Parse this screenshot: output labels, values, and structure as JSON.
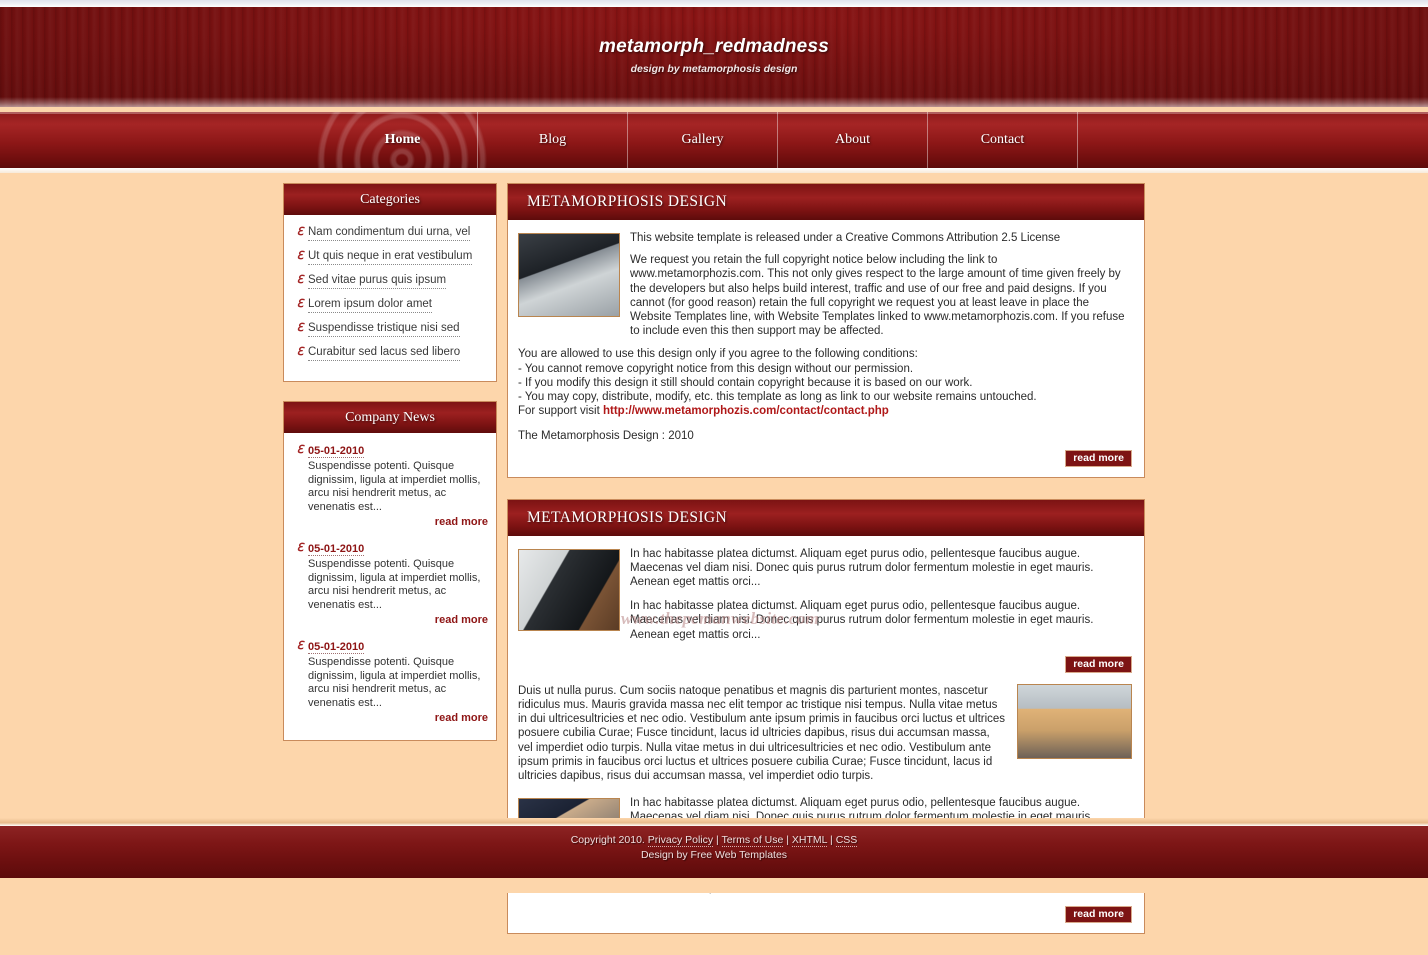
{
  "site": {
    "title": "metamorph_redmadness",
    "subtitle": "design by metamorphosis design",
    "watermark": "www.thepcmanwebsite.com"
  },
  "nav": {
    "items": [
      {
        "label": "Home",
        "active": true
      },
      {
        "label": "Blog",
        "active": false
      },
      {
        "label": "Gallery",
        "active": false
      },
      {
        "label": "About",
        "active": false
      },
      {
        "label": "Contact",
        "active": false
      }
    ]
  },
  "sidebar": {
    "categories": {
      "title": "Categories",
      "bullet": "flourish-bullet",
      "items": [
        "Nam condimentum dui urna, vel",
        "Ut quis neque in erat vestibulum",
        "Sed vitae purus quis ipsum",
        "Lorem ipsum dolor amet",
        "Suspendisse tristique nisi sed",
        "Curabitur sed lacus sed libero"
      ]
    },
    "news": {
      "title": "Company News",
      "read_more": "read more",
      "items": [
        {
          "date": "05-01-2010",
          "text": "Suspendisse potenti. Quisque dignissim, ligula at imperdiet mollis, arcu nisi hendrerit metus, ac venenatis est..."
        },
        {
          "date": "05-01-2010",
          "text": "Suspendisse potenti. Quisque dignissim, ligula at imperdiet mollis, arcu nisi hendrerit metus, ac venenatis est..."
        },
        {
          "date": "05-01-2010",
          "text": "Suspendisse potenti. Quisque dignissim, ligula at imperdiet mollis, arcu nisi hendrerit metus, ac venenatis est..."
        }
      ]
    }
  },
  "main": {
    "article1": {
      "heading": "METAMORPHOSIS DESIGN",
      "image_alt": "computer-desk-photo",
      "p1": "This website template is released under a Creative Commons Attribution 2.5 License",
      "p2": "We request you retain the full copyright notice below including the link to www.metamorphozis.com. This not only gives respect to the large amount of time given freely by the developers but also helps build interest, traffic and use of our free and paid designs. If you cannot (for good reason) retain the full copyright we request you at least leave in place the Website Templates line, with Website Templates linked to www.metamorphozis.com. If you refuse to include even this then support may be affected.",
      "conditions_intro": "You are allowed to use this design only if you agree to the following conditions:",
      "condition1": "- You cannot remove copyright notice from this design without our permission.",
      "condition2": "- If you modify this design it still should contain copyright because it is based on our work.",
      "condition3": "- You may copy, distribute, modify, etc. this template as long as link to our website remains untouched.",
      "support_label": "For support visit ",
      "support_link": "http://www.metamorphozis.com/contact/contact.php",
      "signature": "The Metamorphosis Design : 2010",
      "read_more": "read more"
    },
    "article2": {
      "heading": "METAMORPHOSIS DESIGN",
      "image1_alt": "monitor-photo",
      "image2_alt": "meeting-room-photo",
      "image3_alt": "business-group-photo",
      "p1": "In hac habitasse platea dictumst. Aliquam eget purus odio, pellentesque faucibus augue. Maecenas vel diam nisi. Donec quis purus rutrum dolor fermentum molestie in eget mauris. Aenean eget mattis orci...",
      "p2": "In hac habitasse platea dictumst. Aliquam eget purus odio, pellentesque faucibus augue. Maecenas vel diam nisi. Donec quis purus rutrum dolor fermentum molestie in eget mauris. Aenean eget mattis orci...",
      "read_more_1": "read more",
      "p3": "Duis ut nulla purus. Cum sociis natoque penatibus et magnis dis parturient montes, nascetur ridiculus mus. Mauris gravida massa nec elit tempor ac tristique nisi tempus. Nulla vitae metus in dui ultricesultricies et nec odio. Vestibulum ante ipsum primis in faucibus orci luctus et ultrices posuere cubilia Curae; Fusce tincidunt, lacus id ultricies dapibus, risus dui accumsan massa, vel imperdiet odio turpis. Nulla vitae metus in dui ultricesultricies et nec odio. Vestibulum ante ipsum primis in faucibus orci luctus et ultrices posuere cubilia Curae; Fusce tincidunt, lacus id ultricies dapibus, risus dui accumsan massa, vel imperdiet odio turpis.",
      "p4": "In hac habitasse platea dictumst. Aliquam eget purus odio, pellentesque faucibus augue. Maecenas vel diam nisi. Donec quis purus rutrum dolor fermentum molestie in eget mauris. Aenean eget mattis orci Ut id ultricies nulla. Proin lectus justo, aliquam a malesuada non, rhoncus in mauris. Etiam iaculis urna In hac habitasse platea dictumst. Aliquam eget purus odio, pellentesque faucibus augue. Maecenas vel diam nisi. Donec quis purus rutrum dolor fermentum molestie in eget mauris. Aenean eget mattis orci Ut id ultricies nulla. Proin lectus justo, aliquam a malesuada non, rhoncus in mauris. Etiam iaculis urna",
      "read_more_2": "read more"
    }
  },
  "footer": {
    "copyright": "Copyright 2010. ",
    "privacy": "Privacy Policy",
    "sep1": " | ",
    "terms": "Terms of Use",
    "sep2": " | ",
    "xhtml": "XHTML",
    "sep3": " | ",
    "css": "CSS",
    "design_by": "Design by Free Web Templates"
  },
  "colors": {
    "page_background": "#fdd6ab",
    "dark_red": "#7d1313",
    "accent_red": "#9c2020",
    "link_red": "#b01818",
    "panel_border": "#c98b5c"
  }
}
